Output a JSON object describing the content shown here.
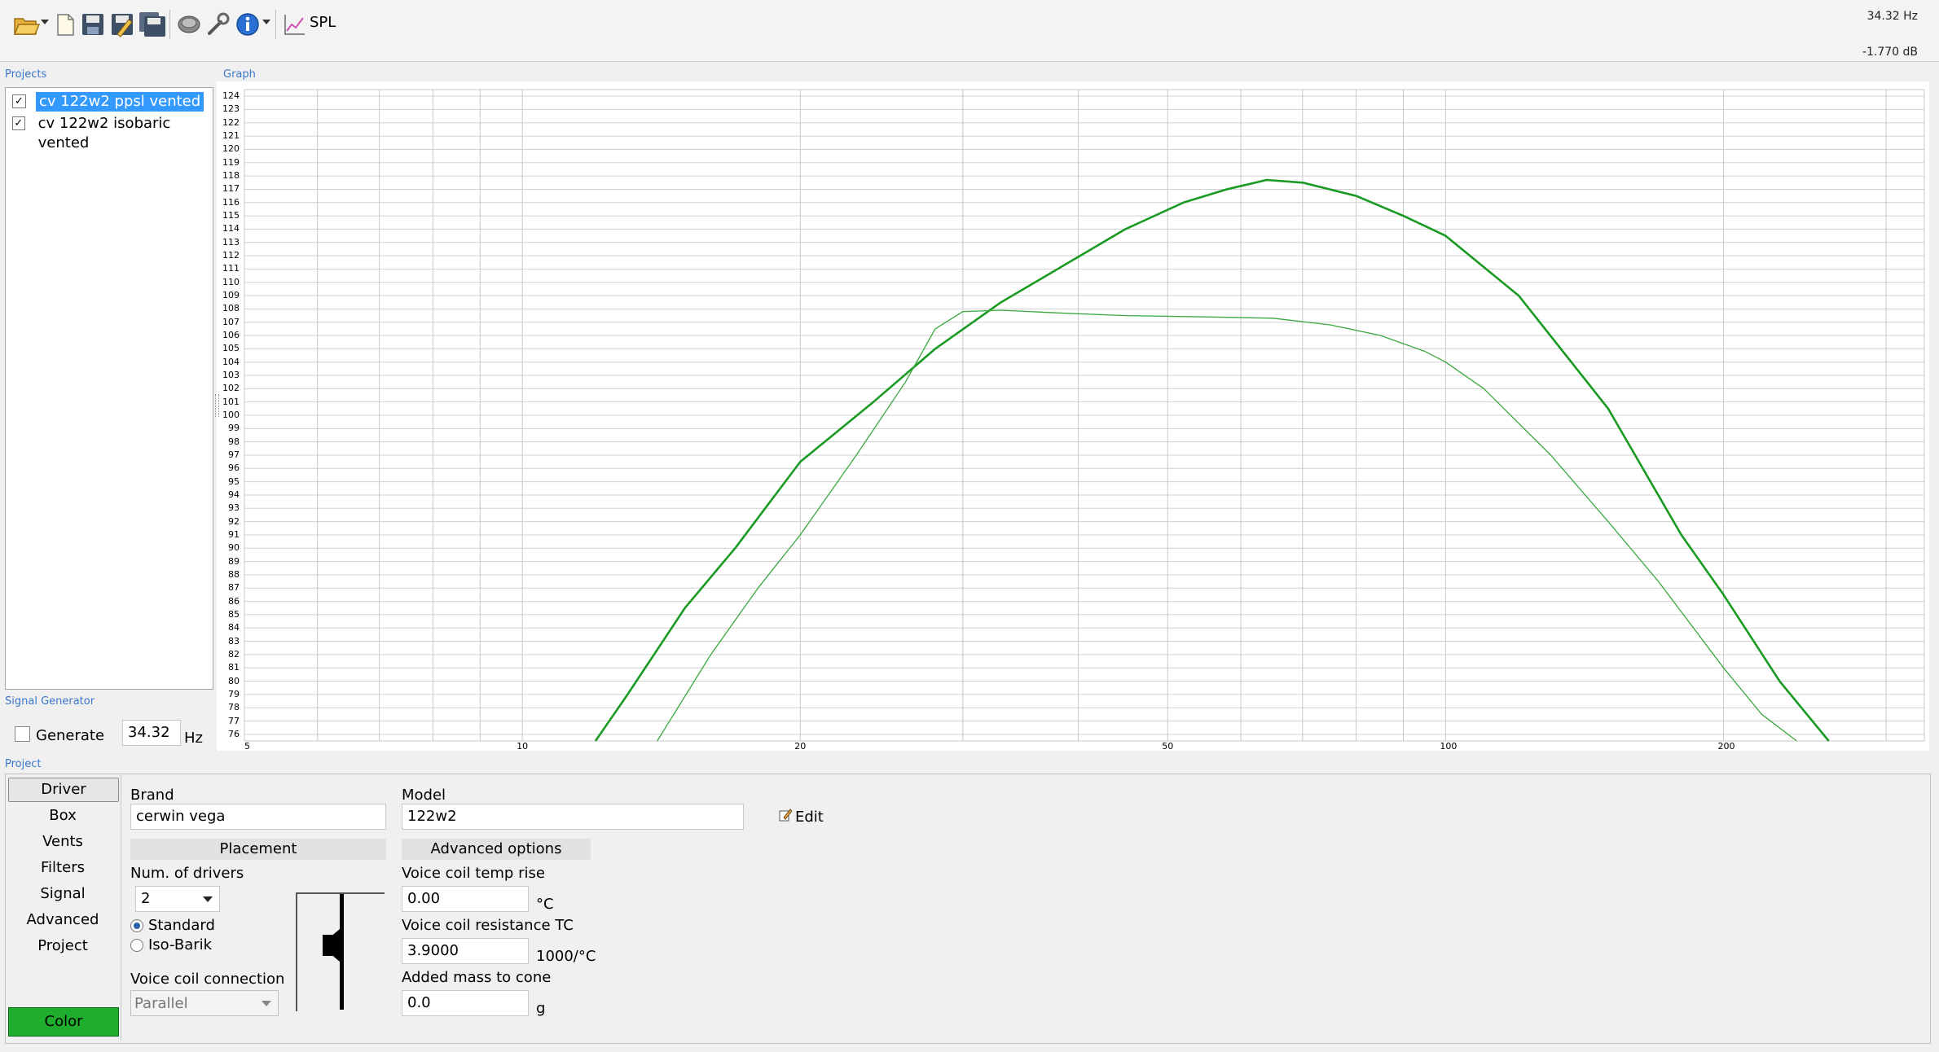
{
  "toolbar": {
    "spl_label": "SPL",
    "readout_freq": "34.32 Hz",
    "readout_db": "-1.770 dB",
    "icons": [
      "open-folder-icon",
      "new-document-icon",
      "save-icon",
      "save-as-icon",
      "save-all-icon",
      "driver-icon",
      "wrench-icon",
      "info-icon",
      "graph-icon"
    ]
  },
  "panels": {
    "projects_label": "Projects",
    "graph_label": "Graph",
    "signal_generator_label": "Signal Generator",
    "project_label": "Project"
  },
  "projects": [
    {
      "label": "cv 122w2 ppsl vented",
      "checked": true,
      "selected": true
    },
    {
      "label": "cv 122w2 isobaric vented",
      "checked": true,
      "selected": false
    }
  ],
  "signal_generator": {
    "generate_label": "Generate",
    "generate_checked": false,
    "frequency": "34.32",
    "unit": "Hz"
  },
  "sidebar": {
    "items": [
      "Driver",
      "Box",
      "Vents",
      "Filters",
      "Signal",
      "Advanced",
      "Project"
    ],
    "active": "Driver",
    "color_button": "Color",
    "color_value": "#1fad2e"
  },
  "driver": {
    "brand_label": "Brand",
    "brand_value": "cerwin vega",
    "model_label": "Model",
    "model_value": "122w2",
    "edit_label": "Edit",
    "placement_header": "Placement",
    "advanced_header": "Advanced options",
    "num_drivers_label": "Num. of drivers",
    "num_drivers_value": "2",
    "standard_label": "Standard",
    "isobarik_label": "Iso-Barik",
    "placement_selected": "Standard",
    "vc_connection_label": "Voice coil connection",
    "vc_connection_value": "Parallel",
    "vc_temp_label": "Voice coil temp rise",
    "vc_temp_value": "0.00",
    "vc_temp_unit": "°C",
    "vc_tc_label": "Voice coil resistance TC",
    "vc_tc_value": "3.9000",
    "vc_tc_unit": "1000/°C",
    "mass_label": "Added mass to cone",
    "mass_value": "0.0",
    "mass_unit": "g"
  },
  "chart_data": {
    "type": "line",
    "x_scale": "log",
    "xlim": [
      5,
      330
    ],
    "ylim": [
      75.5,
      124.5
    ],
    "x_tick_labels": [
      "5",
      "10",
      "20",
      "50",
      "100",
      "200"
    ],
    "y_ticks_from": 76,
    "y_ticks_to": 124,
    "grid": true,
    "series": [
      {
        "color": "#1a9a22",
        "stroke": "thick",
        "x": [
          12,
          13,
          15,
          17,
          20,
          24,
          28,
          33,
          38,
          45,
          52,
          58,
          64,
          70,
          80,
          90,
          100,
          120,
          150,
          180,
          200,
          230,
          260
        ],
        "y": [
          75.5,
          79.0,
          85.5,
          90.0,
          96.5,
          101.0,
          105.0,
          108.5,
          111.0,
          114.0,
          116.0,
          117.0,
          117.7,
          117.5,
          116.5,
          115.0,
          113.5,
          109.0,
          100.5,
          91.0,
          86.5,
          80.0,
          75.5
        ]
      },
      {
        "color": "#3aa83f",
        "stroke": "thin",
        "x": [
          14,
          16,
          18,
          20,
          23,
          26,
          28,
          30,
          33,
          38,
          45,
          55,
          65,
          75,
          85,
          95,
          100,
          110,
          130,
          150,
          170,
          200,
          220,
          240
        ],
        "y": [
          75.5,
          82.0,
          87.0,
          91.0,
          97.0,
          102.5,
          106.5,
          107.8,
          107.9,
          107.7,
          107.5,
          107.4,
          107.3,
          106.8,
          106.0,
          104.8,
          104.0,
          102.0,
          97.0,
          92.0,
          87.5,
          81.0,
          77.5,
          75.5
        ]
      }
    ]
  }
}
